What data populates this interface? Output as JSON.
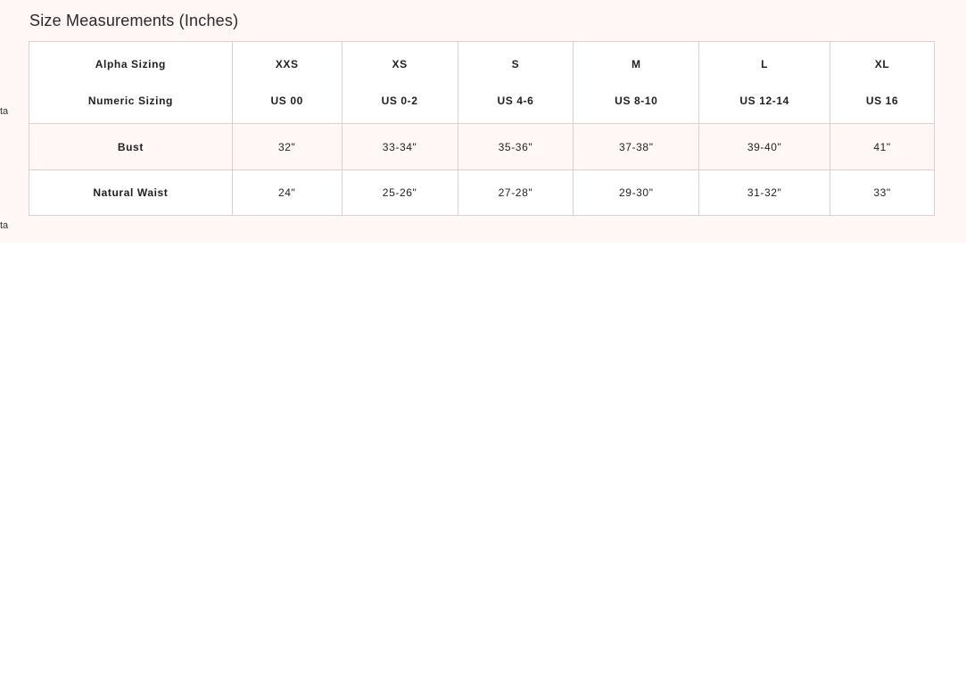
{
  "title": "Size Measurements (Inches)",
  "edge_text": [
    "ta",
    "ta"
  ],
  "table": {
    "header": {
      "alpha_label": "Alpha Sizing",
      "numeric_label": "Numeric Sizing",
      "sizes": [
        {
          "alpha": "XXS",
          "numeric": "US 00"
        },
        {
          "alpha": "XS",
          "numeric": "US 0-2"
        },
        {
          "alpha": "S",
          "numeric": "US 4-6"
        },
        {
          "alpha": "M",
          "numeric": "US 8-10"
        },
        {
          "alpha": "L",
          "numeric": "US 12-14"
        },
        {
          "alpha": "XL",
          "numeric": "US 16"
        }
      ]
    },
    "rows": [
      {
        "label": "Bust",
        "values": [
          "32\"",
          "33-34\"",
          "35-36\"",
          "37-38\"",
          "39-40\"",
          "41\""
        ]
      },
      {
        "label": "Natural Waist",
        "values": [
          "24\"",
          "25-26\"",
          "27-28\"",
          "29-30\"",
          "31-32\"",
          "33\""
        ]
      }
    ]
  }
}
